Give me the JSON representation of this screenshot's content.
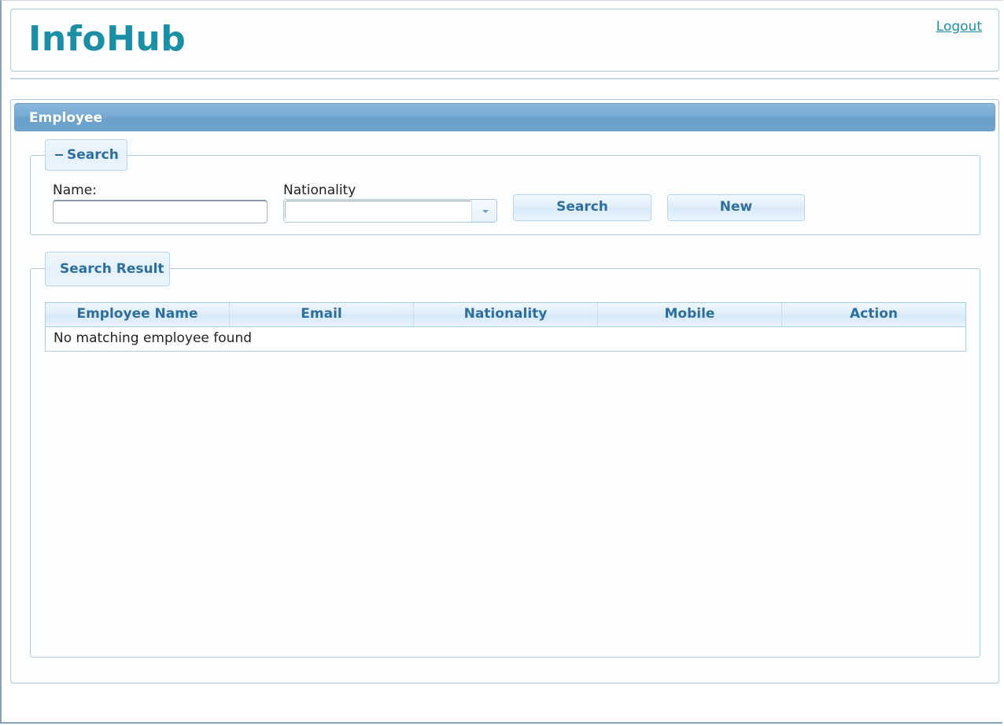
{
  "header": {
    "app_title": "InfoHub",
    "logout_label": "Logout"
  },
  "panel": {
    "title": "Employee"
  },
  "search": {
    "legend": "Search",
    "collapse_icon": "minus-icon",
    "name_label": "Name:",
    "name_value": "",
    "nationality_label": "Nationality",
    "nationality_value": "",
    "search_button": "Search",
    "new_button": "New"
  },
  "results": {
    "legend": "Search Result",
    "columns": [
      "Employee Name",
      "Email",
      "Nationality",
      "Mobile",
      "Action"
    ],
    "empty_message": "No matching employee found"
  },
  "colors": {
    "brand": "#1a8fa6",
    "panel_header": "#78aad2",
    "accent_text": "#2e6e9e"
  }
}
